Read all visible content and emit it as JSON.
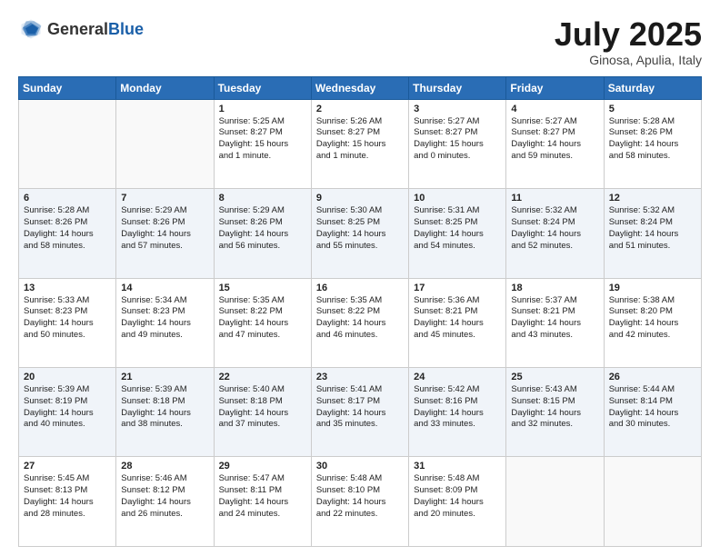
{
  "header": {
    "logo_general": "General",
    "logo_blue": "Blue",
    "month_title": "July 2025",
    "location": "Ginosa, Apulia, Italy"
  },
  "days_of_week": [
    "Sunday",
    "Monday",
    "Tuesday",
    "Wednesday",
    "Thursday",
    "Friday",
    "Saturday"
  ],
  "weeks": [
    [
      {
        "day": "",
        "sunrise": "",
        "sunset": "",
        "daylight": ""
      },
      {
        "day": "",
        "sunrise": "",
        "sunset": "",
        "daylight": ""
      },
      {
        "day": "1",
        "sunrise": "Sunrise: 5:25 AM",
        "sunset": "Sunset: 8:27 PM",
        "daylight": "Daylight: 15 hours and 1 minute."
      },
      {
        "day": "2",
        "sunrise": "Sunrise: 5:26 AM",
        "sunset": "Sunset: 8:27 PM",
        "daylight": "Daylight: 15 hours and 1 minute."
      },
      {
        "day": "3",
        "sunrise": "Sunrise: 5:27 AM",
        "sunset": "Sunset: 8:27 PM",
        "daylight": "Daylight: 15 hours and 0 minutes."
      },
      {
        "day": "4",
        "sunrise": "Sunrise: 5:27 AM",
        "sunset": "Sunset: 8:27 PM",
        "daylight": "Daylight: 14 hours and 59 minutes."
      },
      {
        "day": "5",
        "sunrise": "Sunrise: 5:28 AM",
        "sunset": "Sunset: 8:26 PM",
        "daylight": "Daylight: 14 hours and 58 minutes."
      }
    ],
    [
      {
        "day": "6",
        "sunrise": "Sunrise: 5:28 AM",
        "sunset": "Sunset: 8:26 PM",
        "daylight": "Daylight: 14 hours and 58 minutes."
      },
      {
        "day": "7",
        "sunrise": "Sunrise: 5:29 AM",
        "sunset": "Sunset: 8:26 PM",
        "daylight": "Daylight: 14 hours and 57 minutes."
      },
      {
        "day": "8",
        "sunrise": "Sunrise: 5:29 AM",
        "sunset": "Sunset: 8:26 PM",
        "daylight": "Daylight: 14 hours and 56 minutes."
      },
      {
        "day": "9",
        "sunrise": "Sunrise: 5:30 AM",
        "sunset": "Sunset: 8:25 PM",
        "daylight": "Daylight: 14 hours and 55 minutes."
      },
      {
        "day": "10",
        "sunrise": "Sunrise: 5:31 AM",
        "sunset": "Sunset: 8:25 PM",
        "daylight": "Daylight: 14 hours and 54 minutes."
      },
      {
        "day": "11",
        "sunrise": "Sunrise: 5:32 AM",
        "sunset": "Sunset: 8:24 PM",
        "daylight": "Daylight: 14 hours and 52 minutes."
      },
      {
        "day": "12",
        "sunrise": "Sunrise: 5:32 AM",
        "sunset": "Sunset: 8:24 PM",
        "daylight": "Daylight: 14 hours and 51 minutes."
      }
    ],
    [
      {
        "day": "13",
        "sunrise": "Sunrise: 5:33 AM",
        "sunset": "Sunset: 8:23 PM",
        "daylight": "Daylight: 14 hours and 50 minutes."
      },
      {
        "day": "14",
        "sunrise": "Sunrise: 5:34 AM",
        "sunset": "Sunset: 8:23 PM",
        "daylight": "Daylight: 14 hours and 49 minutes."
      },
      {
        "day": "15",
        "sunrise": "Sunrise: 5:35 AM",
        "sunset": "Sunset: 8:22 PM",
        "daylight": "Daylight: 14 hours and 47 minutes."
      },
      {
        "day": "16",
        "sunrise": "Sunrise: 5:35 AM",
        "sunset": "Sunset: 8:22 PM",
        "daylight": "Daylight: 14 hours and 46 minutes."
      },
      {
        "day": "17",
        "sunrise": "Sunrise: 5:36 AM",
        "sunset": "Sunset: 8:21 PM",
        "daylight": "Daylight: 14 hours and 45 minutes."
      },
      {
        "day": "18",
        "sunrise": "Sunrise: 5:37 AM",
        "sunset": "Sunset: 8:21 PM",
        "daylight": "Daylight: 14 hours and 43 minutes."
      },
      {
        "day": "19",
        "sunrise": "Sunrise: 5:38 AM",
        "sunset": "Sunset: 8:20 PM",
        "daylight": "Daylight: 14 hours and 42 minutes."
      }
    ],
    [
      {
        "day": "20",
        "sunrise": "Sunrise: 5:39 AM",
        "sunset": "Sunset: 8:19 PM",
        "daylight": "Daylight: 14 hours and 40 minutes."
      },
      {
        "day": "21",
        "sunrise": "Sunrise: 5:39 AM",
        "sunset": "Sunset: 8:18 PM",
        "daylight": "Daylight: 14 hours and 38 minutes."
      },
      {
        "day": "22",
        "sunrise": "Sunrise: 5:40 AM",
        "sunset": "Sunset: 8:18 PM",
        "daylight": "Daylight: 14 hours and 37 minutes."
      },
      {
        "day": "23",
        "sunrise": "Sunrise: 5:41 AM",
        "sunset": "Sunset: 8:17 PM",
        "daylight": "Daylight: 14 hours and 35 minutes."
      },
      {
        "day": "24",
        "sunrise": "Sunrise: 5:42 AM",
        "sunset": "Sunset: 8:16 PM",
        "daylight": "Daylight: 14 hours and 33 minutes."
      },
      {
        "day": "25",
        "sunrise": "Sunrise: 5:43 AM",
        "sunset": "Sunset: 8:15 PM",
        "daylight": "Daylight: 14 hours and 32 minutes."
      },
      {
        "day": "26",
        "sunrise": "Sunrise: 5:44 AM",
        "sunset": "Sunset: 8:14 PM",
        "daylight": "Daylight: 14 hours and 30 minutes."
      }
    ],
    [
      {
        "day": "27",
        "sunrise": "Sunrise: 5:45 AM",
        "sunset": "Sunset: 8:13 PM",
        "daylight": "Daylight: 14 hours and 28 minutes."
      },
      {
        "day": "28",
        "sunrise": "Sunrise: 5:46 AM",
        "sunset": "Sunset: 8:12 PM",
        "daylight": "Daylight: 14 hours and 26 minutes."
      },
      {
        "day": "29",
        "sunrise": "Sunrise: 5:47 AM",
        "sunset": "Sunset: 8:11 PM",
        "daylight": "Daylight: 14 hours and 24 minutes."
      },
      {
        "day": "30",
        "sunrise": "Sunrise: 5:48 AM",
        "sunset": "Sunset: 8:10 PM",
        "daylight": "Daylight: 14 hours and 22 minutes."
      },
      {
        "day": "31",
        "sunrise": "Sunrise: 5:48 AM",
        "sunset": "Sunset: 8:09 PM",
        "daylight": "Daylight: 14 hours and 20 minutes."
      },
      {
        "day": "",
        "sunrise": "",
        "sunset": "",
        "daylight": ""
      },
      {
        "day": "",
        "sunrise": "",
        "sunset": "",
        "daylight": ""
      }
    ]
  ]
}
